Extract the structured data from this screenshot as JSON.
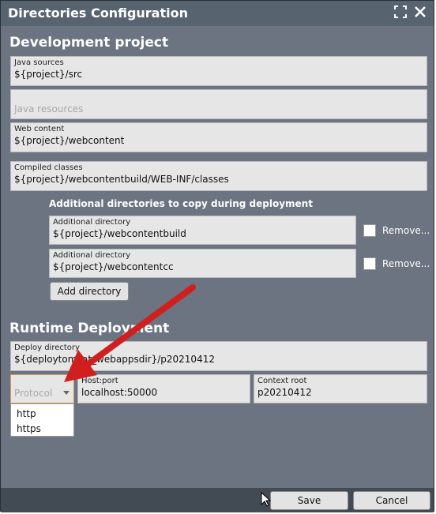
{
  "window": {
    "title": "Directories Configuration",
    "maximize_icon": "maximize-icon",
    "close_icon": "close-icon"
  },
  "development": {
    "title": "Development project",
    "java_sources": {
      "label": "Java sources",
      "value": "${project}/src"
    },
    "java_resources": {
      "placeholder": "Java resources"
    },
    "web_content": {
      "label": "Web content",
      "value": "${project}/webcontent"
    },
    "compiled_classes": {
      "label": "Compiled classes",
      "value": "${project}/webcontentbuild/WEB-INF/classes"
    },
    "additional_title": "Additional directories to copy during deployment",
    "additional": [
      {
        "label": "Additional directory",
        "value": "${project}/webcontentbuild",
        "remove_label": "Remove..."
      },
      {
        "label": "Additional directory",
        "value": "${project}/webcontentcc",
        "remove_label": "Remove..."
      }
    ],
    "add_button": "Add directory"
  },
  "runtime": {
    "title": "Runtime Deployment",
    "deploy_directory": {
      "label": "Deploy directory",
      "value": "${deploytomcat_webappsdir}/p20210412"
    },
    "protocol": {
      "placeholder": "Protocol",
      "options": [
        "http",
        "https"
      ]
    },
    "host_port": {
      "label": "Host:port",
      "value": "localhost:50000"
    },
    "context_root": {
      "label": "Context root",
      "value": "p20210412"
    }
  },
  "footer": {
    "save": "Save",
    "cancel": "Cancel"
  },
  "colors": {
    "titlebar": "#586370",
    "panel": "#6b7480",
    "footer": "#424a54",
    "arrow": "#d01f1f",
    "focus_border": "#d79c56"
  }
}
